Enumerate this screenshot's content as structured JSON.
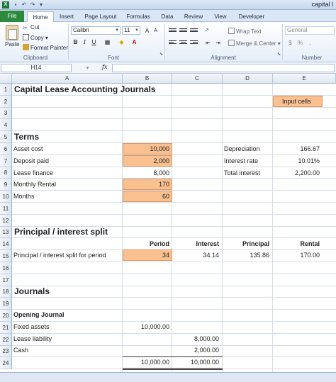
{
  "window": {
    "title": "capital l"
  },
  "ribbon_tabs": [
    "File",
    "Home",
    "Insert",
    "Page Layout",
    "Formulas",
    "Data",
    "Review",
    "View",
    "Developer"
  ],
  "clipboard": {
    "paste": "Paste",
    "cut": "Cut",
    "copy": "Copy",
    "format_painter": "Format Painter",
    "group": "Clipboard"
  },
  "font": {
    "name": "Calibri",
    "size": "11",
    "bold": "B",
    "italic": "I",
    "underline": "U",
    "group": "Font"
  },
  "alignment": {
    "wrap_text": "Wrap Text",
    "merge": "Merge & Center",
    "group": "Alignment"
  },
  "number": {
    "format": "General",
    "group": "Number"
  },
  "formula_bar": {
    "name_box": "H14",
    "fx": "fx",
    "value": ""
  },
  "columns": [
    "A",
    "B",
    "C",
    "D",
    "E"
  ],
  "rows": [
    "1",
    "2",
    "3",
    "4",
    "5",
    "6",
    "7",
    "8",
    "9",
    "10",
    "11",
    "12",
    "13",
    "14",
    "15",
    "16",
    "17",
    "18",
    "19",
    "20",
    "21",
    "22",
    "23",
    "24"
  ],
  "sheet": {
    "title": "Capital Lease Accounting Journals",
    "input_cells_label": "Input cells",
    "terms_heading": "Terms",
    "asset_cost_label": "Asset cost",
    "asset_cost": "10,000",
    "deposit_label": "Deposit paid",
    "deposit": "2,000",
    "lease_finance_label": "Lease finance",
    "lease_finance": "8,000",
    "monthly_rental_label": "Monthly Rental",
    "monthly_rental": "170",
    "months_label": "Months",
    "months": "60",
    "depreciation_label": "Depreciation",
    "depreciation": "166.67",
    "interest_rate_label": "Interest rate",
    "interest_rate": "10.01%",
    "total_interest_label": "Total interest",
    "total_interest": "2,200.00",
    "split_heading": "Principal / interest split",
    "col_period": "Period",
    "col_interest": "Interest",
    "col_principal": "Principal",
    "col_rental": "Rental",
    "split_label": "Principal / interest split for period",
    "period": "34",
    "interest": "34.14",
    "principal": "135.86",
    "rental": "170.00",
    "journals_heading": "Journals",
    "opening_journal": "Opening Journal",
    "fixed_assets_label": "Fixed assets",
    "fixed_assets_dr": "10,000.00",
    "lease_liability_label": "Lease liability",
    "lease_liability_cr": "8,000.00",
    "cash_label": "Cash",
    "cash_cr": "2,000.00",
    "total_dr": "10,000.00",
    "total_cr": "10,000.00"
  },
  "colors": {
    "input_fill": "#fac090",
    "file_tab": "#2c8a3e"
  }
}
